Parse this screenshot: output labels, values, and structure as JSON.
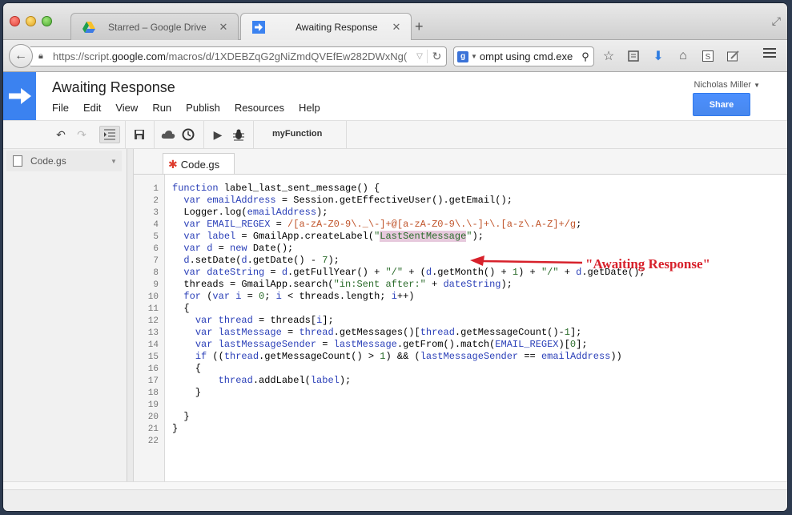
{
  "browser": {
    "tabs": [
      {
        "title": "Starred – Google Drive",
        "active": false,
        "icon": "google-drive-icon"
      },
      {
        "title": "Awaiting Response",
        "active": true,
        "icon": "apps-script-arrow-icon"
      }
    ],
    "url_prefix": "https://script.",
    "url_domain": "google.com",
    "url_suffix": "/macros/d/1XDEBZqG2gNiZmdQVEfEw282DWxNg(",
    "search_value": "ompt using cmd.exe",
    "search_provider": "g"
  },
  "app": {
    "title": "Awaiting Response",
    "menu": [
      "File",
      "Edit",
      "View",
      "Run",
      "Publish",
      "Resources",
      "Help"
    ],
    "user_name": "Nicholas Miller",
    "share_label": "Share",
    "function_select": "myFunction",
    "file_name": "Code.gs",
    "code_tab": "Code.gs"
  },
  "editor": {
    "line_numbers": [
      "1",
      "2",
      "3",
      "4",
      "5",
      "6",
      "7",
      "8",
      "9",
      "10",
      "11",
      "12",
      "13",
      "14",
      "15",
      "16",
      "17",
      "18",
      "19",
      "20",
      "21",
      "22"
    ],
    "annotation": "\"Awaiting Response\""
  },
  "colors": {
    "accent": "#3b82f0",
    "share": "#4d90fe",
    "annotation": "#d7212b",
    "highlight": "#e7c9dd"
  }
}
